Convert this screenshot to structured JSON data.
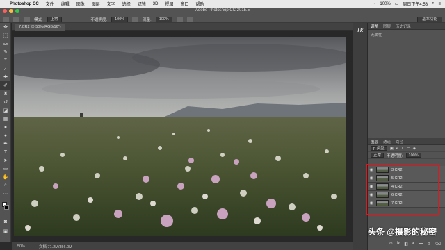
{
  "menubar": {
    "app_name": "Photoshop CC",
    "items": [
      "文件",
      "编辑",
      "图像",
      "图层",
      "文字",
      "选择",
      "滤镜",
      "3D",
      "视图",
      "窗口",
      "帮助"
    ],
    "battery": "100%",
    "clock": "周日下午4:53"
  },
  "window": {
    "title": "Adobe Photoshop CC 2015.5"
  },
  "options": {
    "mode_label": "模式:",
    "mode_value": "正常",
    "opacity_label": "不透明度:",
    "opacity_value": "100%",
    "flow_label": "流量:",
    "flow_value": "100%",
    "workspace": "基本功能"
  },
  "document": {
    "tab_title": "7.CR2 @ 50%(RGB/16*)",
    "zoom": "50%",
    "doc_size": "文档:71.2M/356.0M"
  },
  "panels": {
    "upper_tabs": [
      "调整",
      "图层",
      "历史记录"
    ],
    "upper_text": "无属性"
  },
  "layers": {
    "tabs": [
      "图层",
      "通道",
      "路径"
    ],
    "kind_label": "p 类型",
    "blend_mode": "正常",
    "opacity_label": "不透明度:",
    "opacity_value": "100%",
    "items": [
      "3.CR2",
      "5.CR2",
      "4.CR2",
      "6.CR2",
      "7.CR2"
    ]
  },
  "watermark": "头条 @摄影的秘密",
  "colors": {
    "highlight_frame": "#e8141b"
  }
}
